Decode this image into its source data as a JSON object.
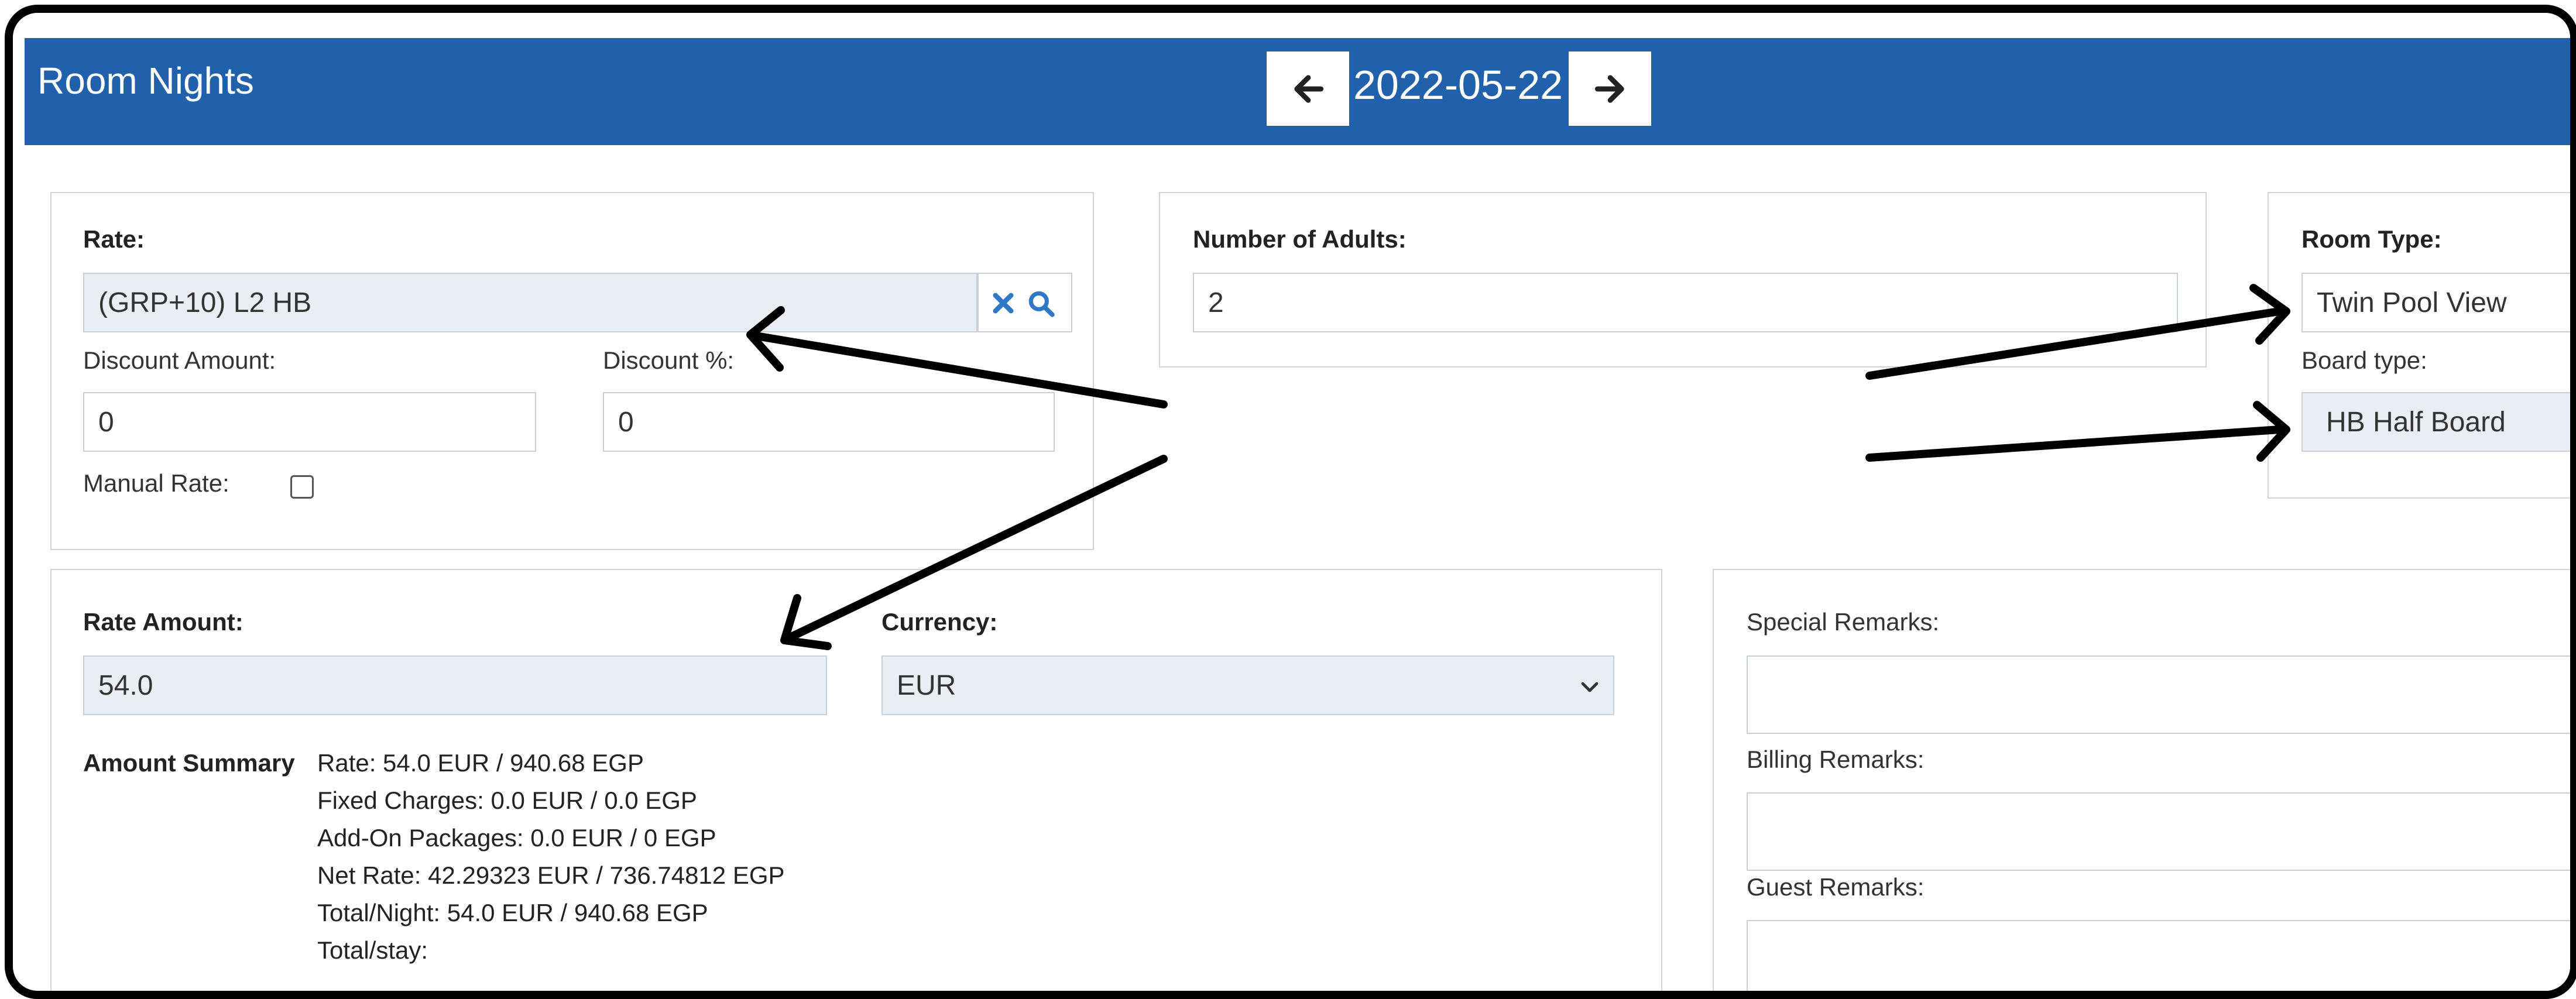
{
  "header": {
    "title": "Room Nights",
    "date": "2022-05-22",
    "prev_icon": "arrow-left-icon",
    "next_icon": "arrow-right-icon"
  },
  "rate_panel": {
    "rate_label": "Rate:",
    "rate_value": "(GRP+10) L2 HB",
    "clear_icon": "close-icon",
    "search_icon": "search-icon",
    "discount_amount_label": "Discount Amount:",
    "discount_amount_value": "0",
    "discount_percent_label": "Discount %:",
    "discount_percent_value": "0",
    "manual_rate_label": "Manual Rate:",
    "manual_rate_checked": false
  },
  "adults_panel": {
    "label": "Number of Adults:",
    "value": "2"
  },
  "room_panel": {
    "room_type_label": "Room Type:",
    "room_type_value": "Twin Pool View",
    "board_type_label": "Board type:",
    "board_type_value": "HB Half Board"
  },
  "amount_panel": {
    "rate_amount_label": "Rate Amount:",
    "rate_amount_value": "54.0",
    "currency_label": "Currency:",
    "currency_value": "EUR",
    "summary_label": "Amount Summary",
    "summary_lines": [
      "Rate: 54.0 EUR / 940.68 EGP",
      "Fixed Charges: 0.0 EUR / 0.0 EGP",
      "Add-On Packages: 0.0 EUR / 0 EGP",
      "Net Rate: 42.29323 EUR / 736.74812 EGP",
      "Total/Night: 54.0 EUR / 940.68 EGP",
      "Total/stay:"
    ]
  },
  "remarks_panel": {
    "special_label": "Special Remarks:",
    "billing_label": "Billing Remarks:",
    "guest_label": "Guest Remarks:"
  },
  "colors": {
    "header_bg": "#2160ab",
    "readonly_bg": "#e9edf4",
    "icon_blue": "#2f77c7"
  }
}
